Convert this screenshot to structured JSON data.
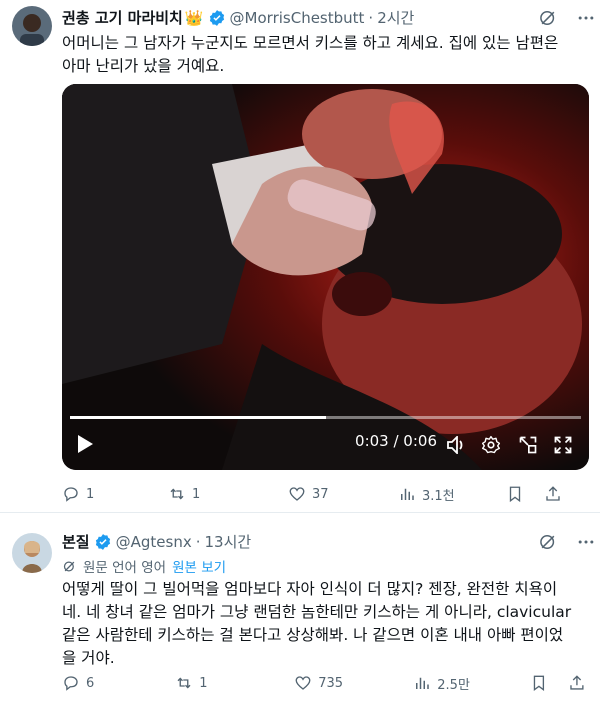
{
  "tweet1": {
    "display_name": "권총 고기 마라비치",
    "crown_emoji": "👑",
    "handle": "@MorrisChestbutt",
    "separator": "·",
    "time": "2시간",
    "text_line1": "어머니는 그 남자가 누군지도 모르면서 키스를 하고 계세요. 집에 있는 남편은",
    "text_line2": "아마 난리가 났을 거예요.",
    "video": {
      "time": "0:03 / 0:06",
      "progress": 0.5
    },
    "stats": {
      "replies": "1",
      "reposts": "1",
      "likes": "37",
      "views": "3.1천"
    }
  },
  "tweet2": {
    "display_name": "본질",
    "handle": "@Agtesnx",
    "separator": "·",
    "time": "13시간",
    "translated_notice": "원문 언어 영어",
    "show_original": "원본 보기",
    "text_lines": [
      "어떻게 딸이 그 빌어먹을 엄마보다 자아 인식이 더 많지? 젠장, 완전한 치욕이",
      "네. 네 창녀 같은 엄마가 그냥 랜덤한 놈한테만 키스하는 게 아니라, clavicular",
      "같은 사람한테 키스하는 걸 본다고 상상해봐. 나 같으면 이혼 내내 아빠 편이었",
      "을 거야."
    ],
    "stats": {
      "replies": "6",
      "reposts": "1",
      "likes": "735",
      "views": "2.5만"
    }
  },
  "colors": {
    "verified": "#1d9bf0",
    "secondary": "#536471",
    "link": "#1d9bf0"
  }
}
